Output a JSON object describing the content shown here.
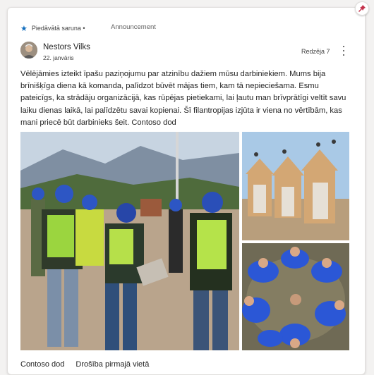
{
  "pin": {
    "icon": "pushpin-icon",
    "color": "#c4314b"
  },
  "header": {
    "featured_label": "Piedāvātā saruna •",
    "category_label": "Announcement",
    "accent": "#0f6cbd"
  },
  "post": {
    "author": "Nestors Vilks",
    "date": "22. janvāris",
    "seen_by": "Redzēja 7",
    "text": "Vēlējāmies izteikt īpašu paziņojumu par atzinību dažiem mūsu darbiniekiem. Mums bija brīnišķīga diena kā komanda, palīdzot būvēt mājas tiem, kam tā nepieciešama. Esmu pateicīgs, ka strādāju organizācijā, kas rūpējas pietiekami, lai ļautu man brīvprātīgi veltīt savu laiku dienas laikā, lai palīdzētu savai kopienai. Šī filantropijas izjūta ir viena no vērtībām, kas mani priecē būt darbinieks šeit. Contoso dod"
  },
  "tags": [
    "Contoso dod",
    "Drošība pirmajā vietā"
  ]
}
